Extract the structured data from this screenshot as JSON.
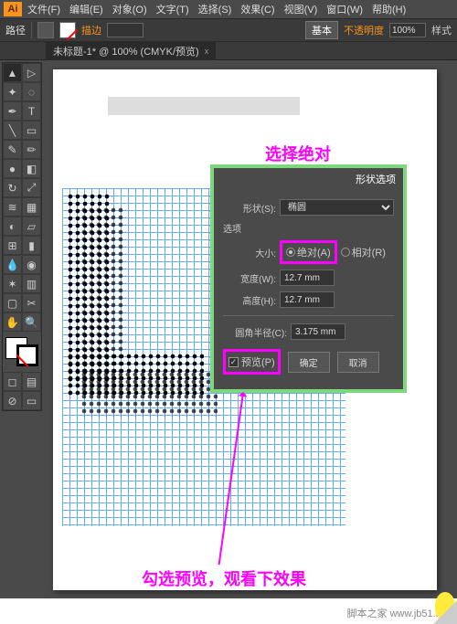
{
  "menu": {
    "file": "文件(F)",
    "edit": "编辑(E)",
    "object": "对象(O)",
    "type": "文字(T)",
    "select": "选择(S)",
    "effect": "效果(C)",
    "view": "视图(V)",
    "window": "窗口(W)",
    "help": "帮助(H)"
  },
  "optbar": {
    "path": "路径",
    "stroke": "描边",
    "basic": "基本",
    "opacity": "不透明度",
    "opacity_val": "100%",
    "style": "样式"
  },
  "tab": {
    "title": "未标题-1* @ 100% (CMYK/预览)",
    "close": "x"
  },
  "dialog": {
    "title": "形状选项",
    "shape_lbl": "形状(S):",
    "shape_val": "椭圆",
    "options": "选项",
    "size_lbl": "大小:",
    "absolute": "绝对(A)",
    "relative": "相对(R)",
    "width_lbl": "宽度(W):",
    "width_val": "12.7 mm",
    "height_lbl": "高度(H):",
    "height_val": "12.7 mm",
    "corner_lbl": "圆角半径(C):",
    "corner_val": "3.175 mm",
    "preview": "预览(P)",
    "ok": "确定",
    "cancel": "取消"
  },
  "anno": {
    "a1": "选择绝对",
    "a2": "勾选预览，观看下效果"
  },
  "watermark": "脚本之家 www.jb51.net",
  "tools": [
    "▲",
    "▶",
    "✦",
    "⬚",
    "T",
    "/",
    "◻",
    "✎",
    "✂",
    "↻",
    "▦",
    "◐",
    "✥",
    "⊞",
    "◧",
    "▭",
    "✶",
    "◉",
    "⬛",
    "⬜",
    "🔍",
    "✋"
  ]
}
